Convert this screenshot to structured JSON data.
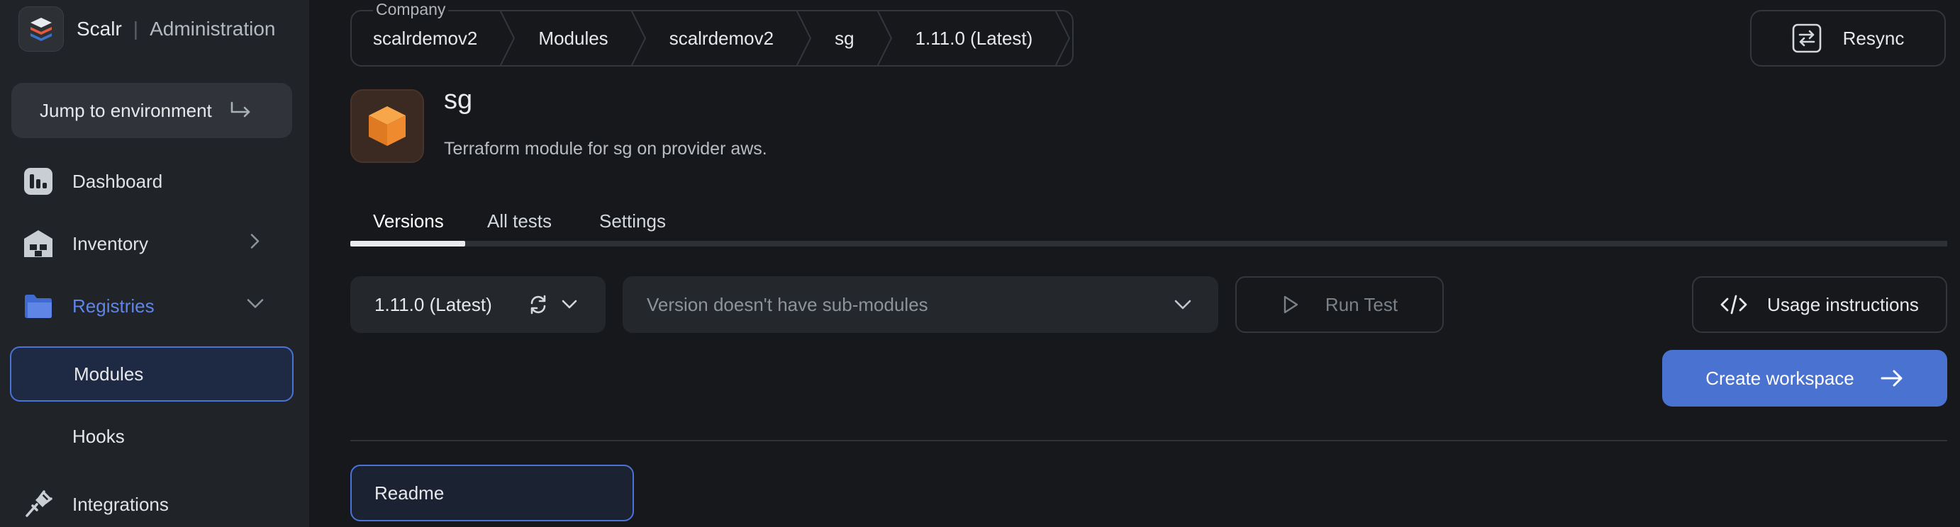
{
  "brand": {
    "name": "Scalr",
    "section": "Administration",
    "logo_icon": "scalr-layers-icon"
  },
  "sidebar": {
    "jump_label": "Jump to environment",
    "items": [
      {
        "label": "Dashboard",
        "icon": "dashboard-icon"
      },
      {
        "label": "Inventory",
        "icon": "warehouse-icon"
      },
      {
        "label": "Registries",
        "icon": "folder-icon"
      },
      {
        "label": "Integrations",
        "icon": "plug-icon"
      }
    ],
    "sub_items": [
      {
        "label": "Modules"
      },
      {
        "label": "Hooks"
      }
    ]
  },
  "breadcrumb": {
    "company_label": "Company",
    "segments": [
      "scalrdemov2",
      "Modules",
      "scalrdemov2",
      "sg",
      "1.11.0 (Latest)"
    ]
  },
  "resync_label": "Resync",
  "module": {
    "name": "sg",
    "description": "Terraform module for sg on provider aws.",
    "icon": "cube-icon"
  },
  "tabs": [
    "Versions",
    "All tests",
    "Settings"
  ],
  "controls": {
    "version": "1.11.0 (Latest)",
    "submodules_placeholder": "Version doesn't have sub-modules",
    "run_test": "Run Test",
    "usage": "Usage instructions",
    "create_workspace": "Create workspace"
  },
  "readme_label": "Readme",
  "colors": {
    "accent": "#4a72d0",
    "active_nav": "#5f86e6",
    "background": "#16181b",
    "sidebar": "#202327",
    "module_orange": "#f0882f"
  }
}
